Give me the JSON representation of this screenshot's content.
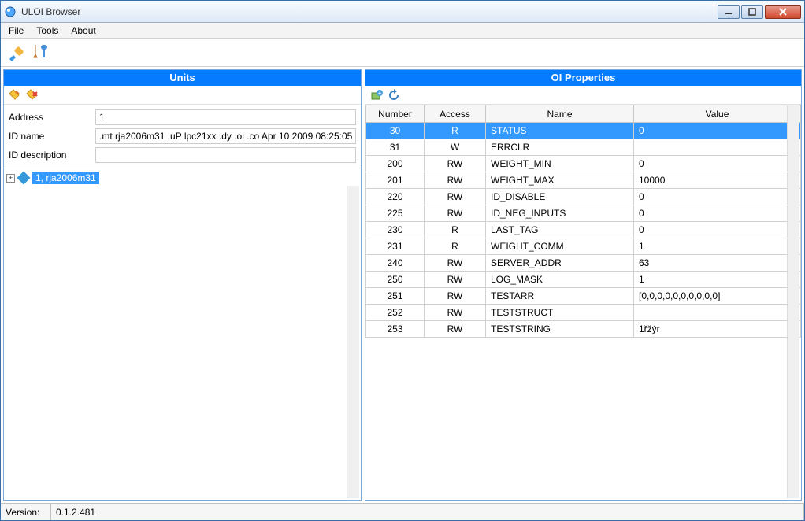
{
  "window": {
    "title": "ULOI Browser"
  },
  "menu": {
    "file": "File",
    "tools": "Tools",
    "about": "About"
  },
  "panels": {
    "units": {
      "title": "Units",
      "fields": {
        "address_label": "Address",
        "address_value": "1",
        "idname_label": "ID name",
        "idname_value": ".mt rja2006m31 .uP lpc21xx .dy .oi .co Apr 10 2009 08:25:05",
        "iddesc_label": "ID description",
        "iddesc_value": ""
      },
      "tree_item": "1, rja2006m31"
    },
    "props": {
      "title": "OI Properties",
      "columns": {
        "number": "Number",
        "access": "Access",
        "name": "Name",
        "value": "Value"
      },
      "rows": [
        {
          "number": "30",
          "access": "R",
          "name": "STATUS",
          "value": "0",
          "selected": true
        },
        {
          "number": "31",
          "access": "W",
          "name": "ERRCLR",
          "value": ""
        },
        {
          "number": "200",
          "access": "RW",
          "name": "WEIGHT_MIN",
          "value": "0"
        },
        {
          "number": "201",
          "access": "RW",
          "name": "WEIGHT_MAX",
          "value": "10000"
        },
        {
          "number": "220",
          "access": "RW",
          "name": "ID_DISABLE",
          "value": "0"
        },
        {
          "number": "225",
          "access": "RW",
          "name": "ID_NEG_INPUTS",
          "value": "0"
        },
        {
          "number": "230",
          "access": "R",
          "name": "LAST_TAG",
          "value": "0"
        },
        {
          "number": "231",
          "access": "R",
          "name": "WEIGHT_COMM",
          "value": "1"
        },
        {
          "number": "240",
          "access": "RW",
          "name": "SERVER_ADDR",
          "value": "63"
        },
        {
          "number": "250",
          "access": "RW",
          "name": "LOG_MASK",
          "value": "1"
        },
        {
          "number": "251",
          "access": "RW",
          "name": "TESTARR",
          "value": "[0,0,0,0,0,0,0,0,0,0]"
        },
        {
          "number": "252",
          "access": "RW",
          "name": "TESTSTRUCT",
          "value": ""
        },
        {
          "number": "253",
          "access": "RW",
          "name": "TESTSTRING",
          "value": "1řžýr"
        }
      ]
    }
  },
  "status": {
    "version_label": "Version:",
    "version_value": "0.1.2.481"
  }
}
